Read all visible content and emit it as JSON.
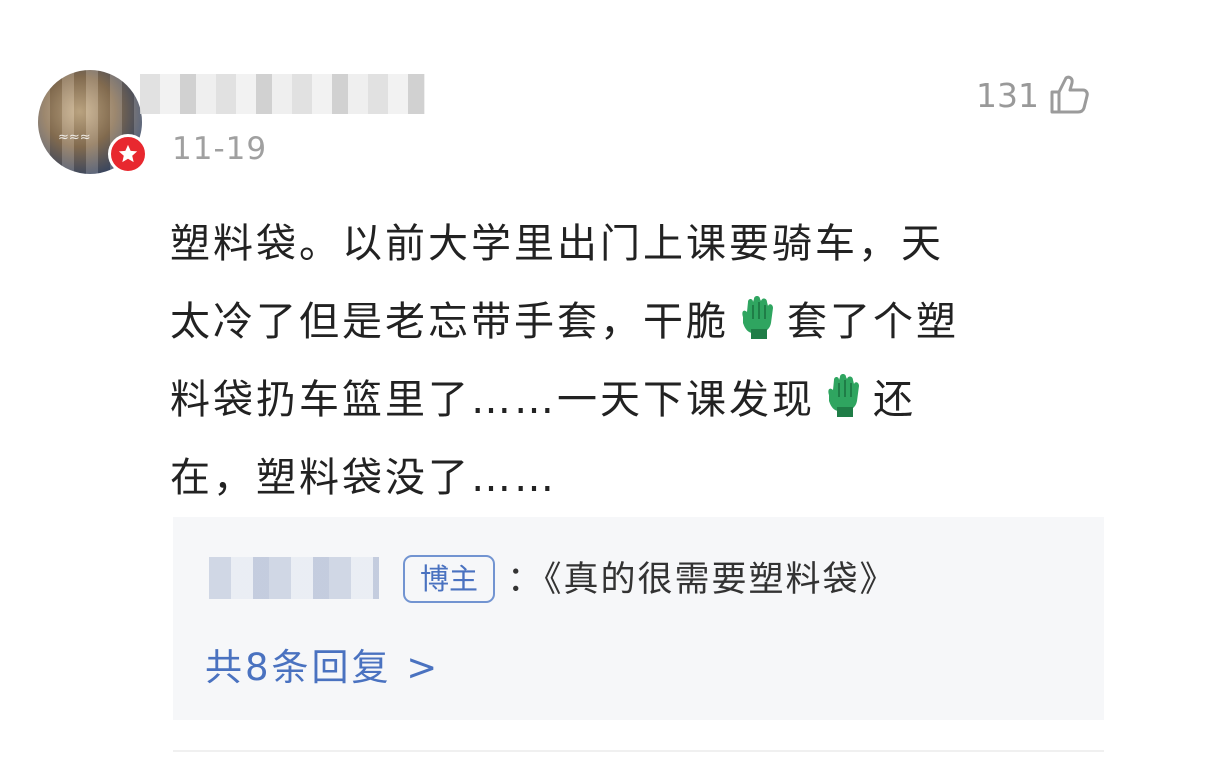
{
  "comment": {
    "date": "11-19",
    "like_count": "131",
    "line1": "塑料袋。以前大学里出门上课要骑车，天",
    "line2a": "太冷了但是老忘带手套，干脆",
    "line2b": "套了个塑",
    "line3a": "料袋扔车篮里了……一天下课发现",
    "line3b": "还",
    "line4": "在，塑料袋没了……",
    "emoji": "glove-emoji",
    "accent_color": "#e8282f"
  },
  "reply": {
    "author_tag": "博主",
    "text": "：《真的很需要塑料袋》",
    "reply_count": "共8条回复 >",
    "link_color": "#4a72c0"
  }
}
